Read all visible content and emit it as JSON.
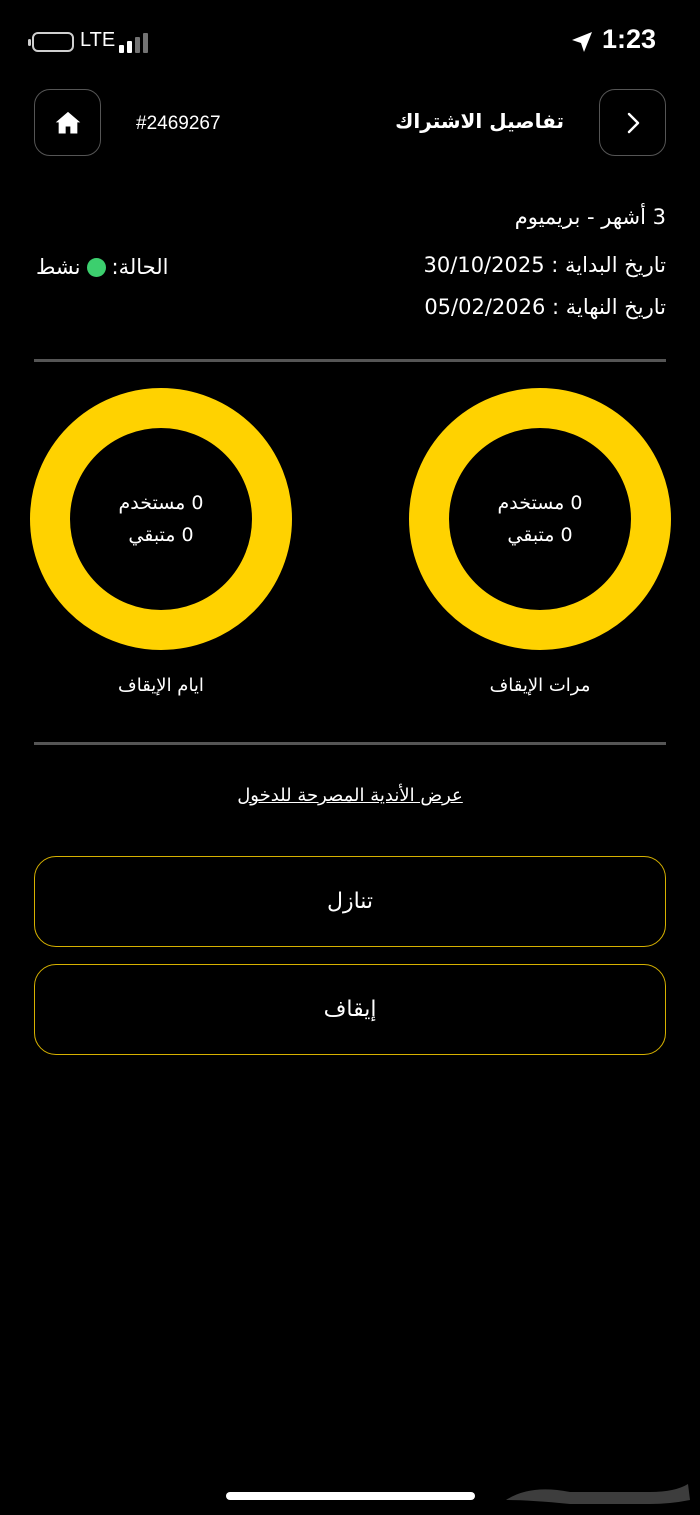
{
  "status_bar": {
    "network": "LTE",
    "time": "1:23"
  },
  "header": {
    "title": "تفاصيل الاشتراك",
    "subscription_id": "#2469267"
  },
  "subscription": {
    "plan": "3 أشهر - بريميوم",
    "start_date_line": "تاريخ البداية : 30/10/2025",
    "end_date_line": "تاريخ النهاية : 05/02/2026",
    "status_label": "الحالة:",
    "status_value": "نشط",
    "status_color": "#3ccf6e"
  },
  "freeze_stats": [
    {
      "label": "مرات الإيقاف",
      "used": "0 مستخدم",
      "remaining": "0 متبقي"
    },
    {
      "label": "ايام الإيقاف",
      "used": "0 مستخدم",
      "remaining": "0 متبقي"
    }
  ],
  "links": {
    "allowed_clubs": "عرض الأندية المصرحة للدخول"
  },
  "actions": {
    "transfer": "تنازل",
    "freeze": "إيقاف"
  },
  "colors": {
    "accent": "#FFD200",
    "background": "#000000"
  },
  "icons": {
    "home": "home-icon",
    "back": "chevron-right-icon"
  }
}
